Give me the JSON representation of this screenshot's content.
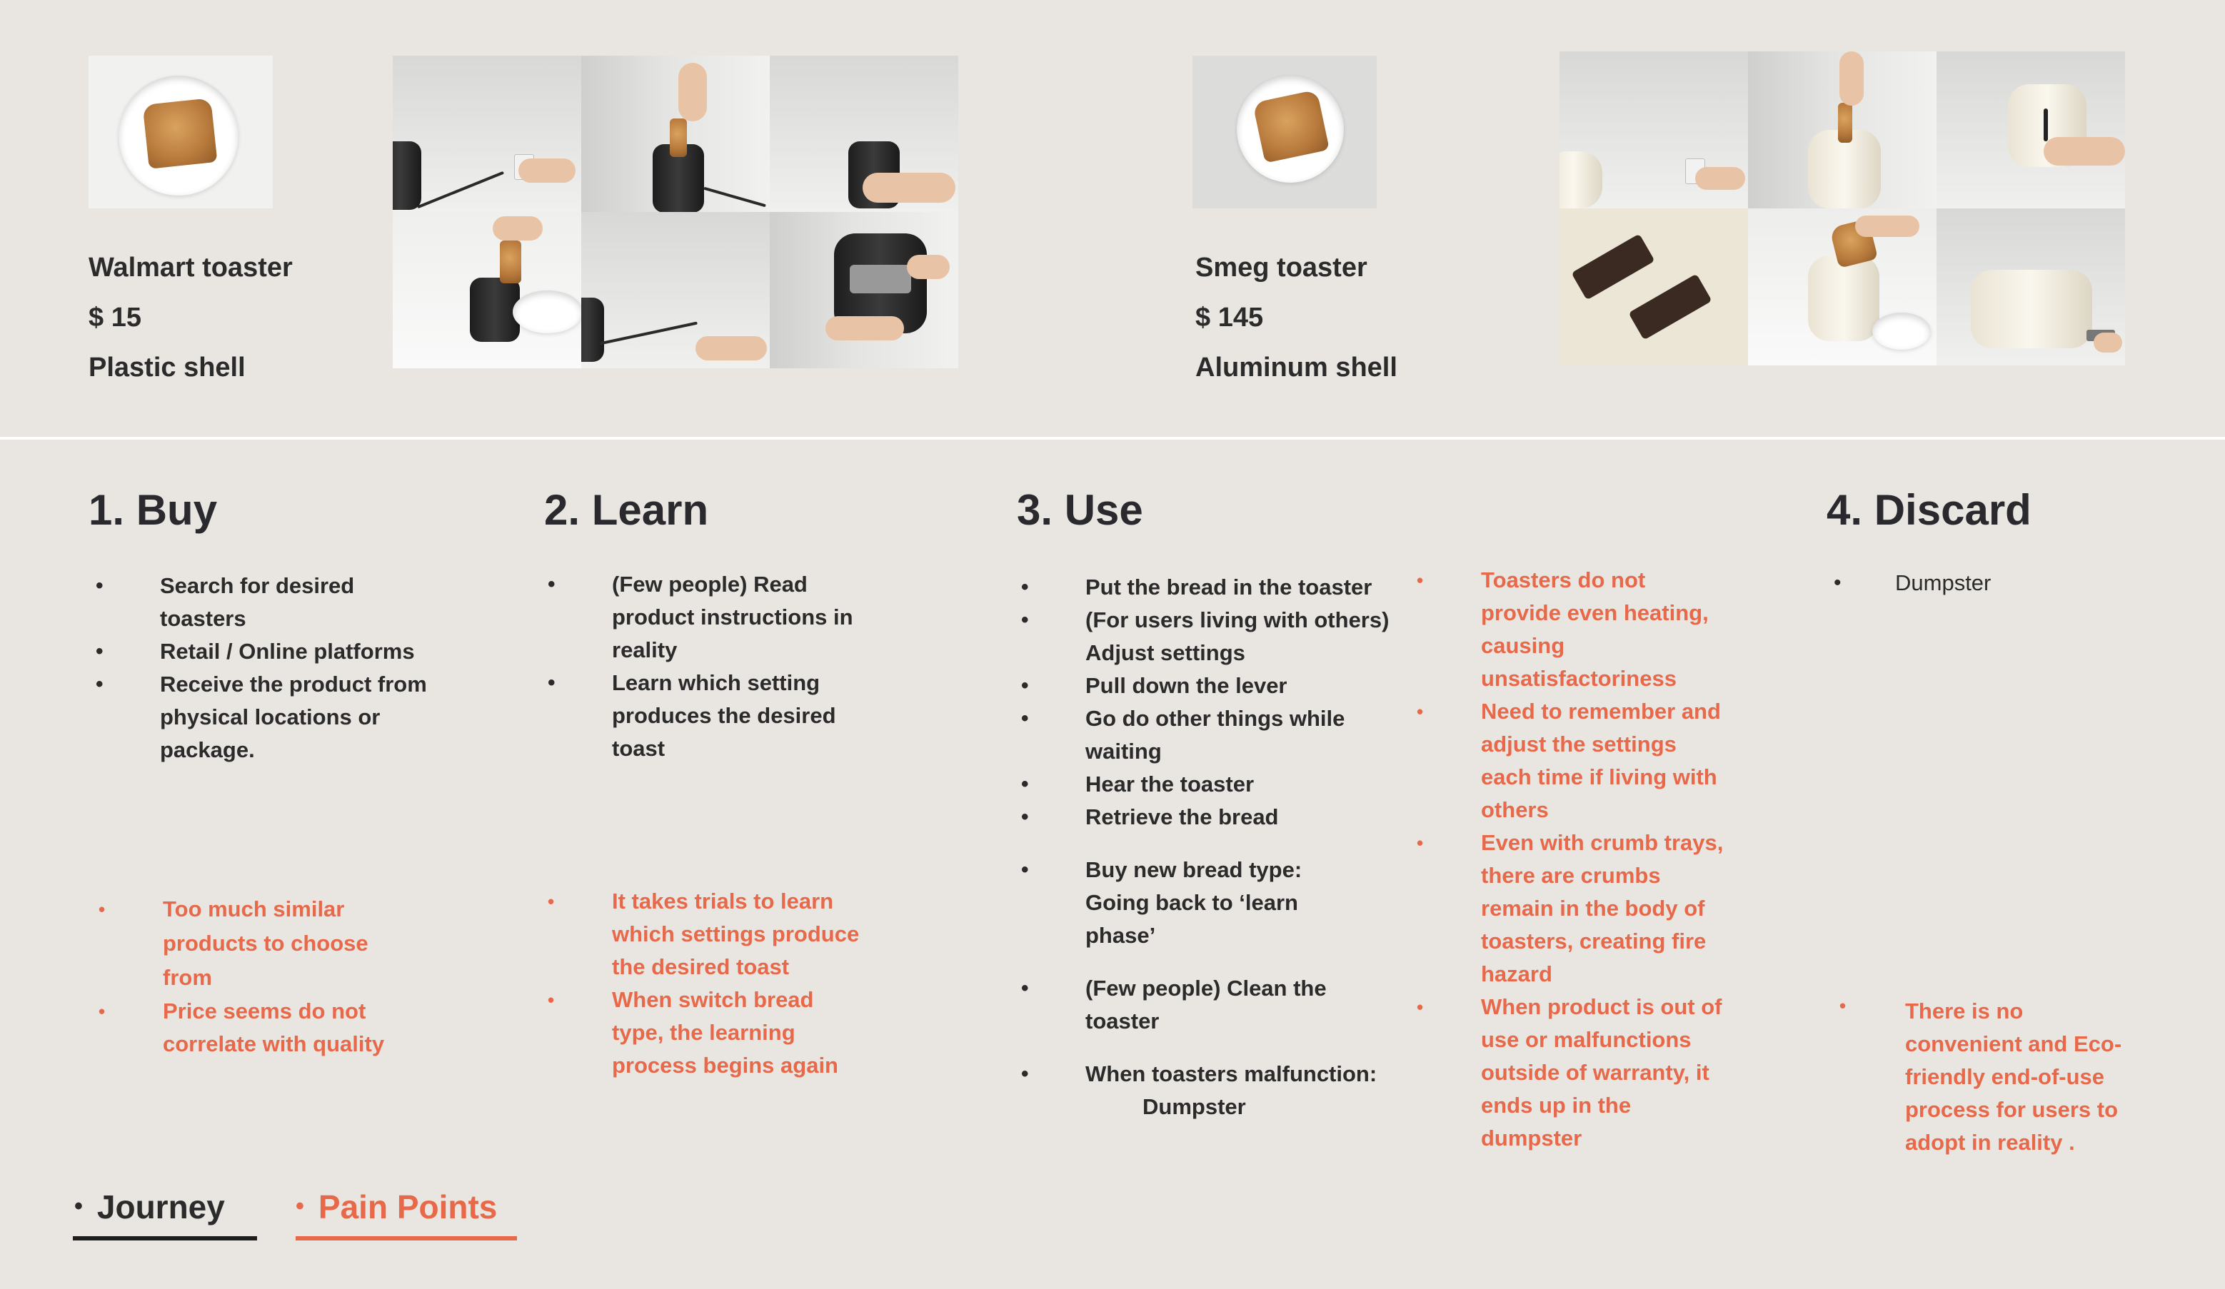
{
  "products": [
    {
      "name": "Walmart toaster",
      "price": "$ 15",
      "material": "Plastic shell"
    },
    {
      "name": "Smeg toaster",
      "price": "$ 145",
      "material": "Aluminum shell"
    }
  ],
  "stages": [
    {
      "title": "1. Buy",
      "journey": [
        "Search for desired toasters",
        "Retail / Online platforms",
        "Receive the product from  physical locations or package."
      ],
      "pain_points": [
        "Too much similar products to choose from",
        "Price seems do not correlate with quality"
      ]
    },
    {
      "title": "2. Learn",
      "journey": [
        "(Few people) Read product instructions in reality",
        "Learn which setting produces the desired toast"
      ],
      "pain_points": [
        "It takes trials to learn which settings produce the desired toast",
        "When switch bread type, the learning process begins again"
      ]
    },
    {
      "title": "3. Use",
      "journey": [
        "Put the bread in the toaster",
        "(For users living with others) Adjust settings",
        "Pull down the lever",
        "Go do other things while waiting",
        "Hear the toaster",
        "Retrieve the bread",
        "Buy new bread type: Going back to ‘learn phase’",
        "(Few people) Clean the toaster",
        "When toasters malfunction:",
        "Dumpster"
      ],
      "pain_points": [
        "Toasters do not provide even heating, causing unsatisfactoriness",
        "Need to remember and adjust the settings each time if living with others",
        "Even with crumb trays, there are crumbs remain in the body of toasters, creating fire hazard",
        "When product is out of use or malfunctions outside of warranty",
        ", it ends up in the dumpster"
      ]
    },
    {
      "title": "4. Discard",
      "journey": [
        "Dumpster"
      ],
      "pain_points": [
        "There is no convenient and Eco-friendly end-of-use process for users to adopt in reality",
        "."
      ]
    }
  ],
  "legend": {
    "journey_label": "Journey",
    "pain_label": "Pain Points",
    "bullet": "•"
  },
  "colors": {
    "background": "#e9e6e1",
    "text": "#2b2b2b",
    "accent": "#e8684a",
    "divider": "#ffffff"
  }
}
